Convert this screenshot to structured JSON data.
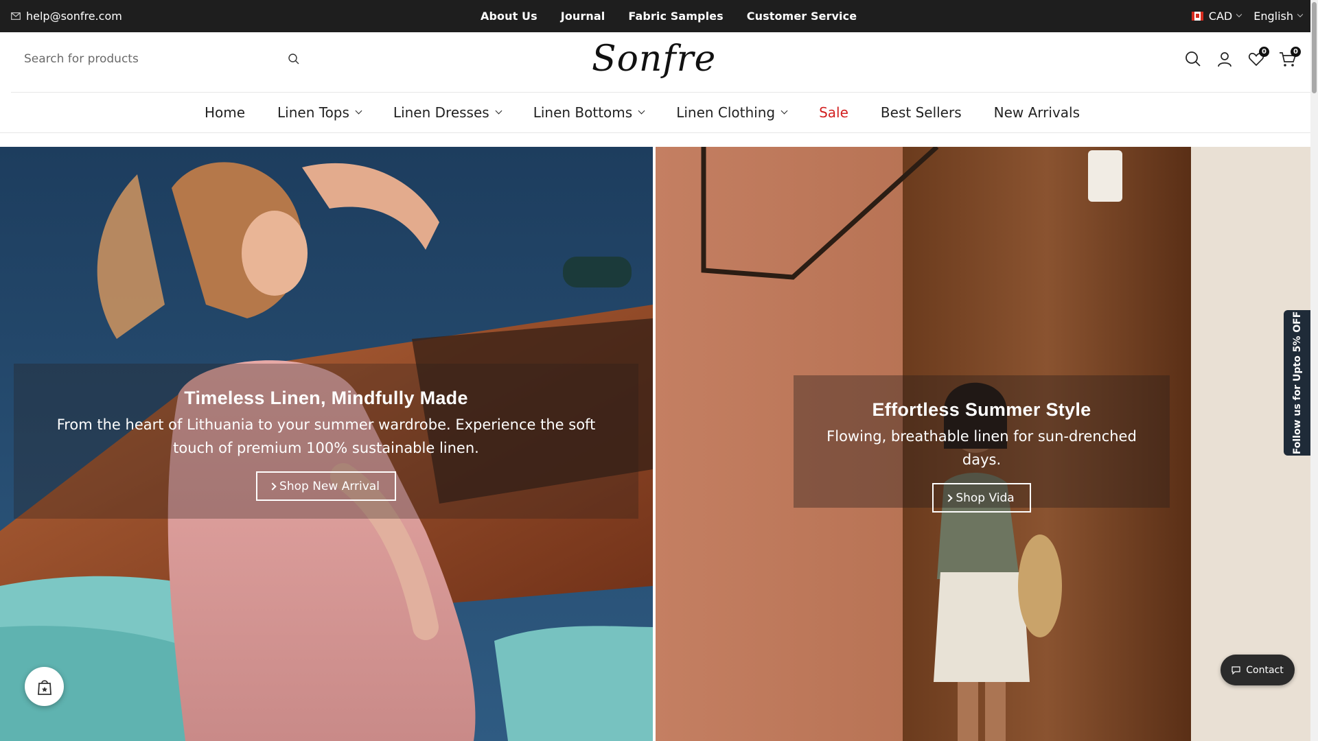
{
  "topbar": {
    "email": "help@sonfre.com",
    "links": [
      "About Us",
      "Journal",
      "Fabric Samples",
      "Customer Service"
    ],
    "currency": "CAD",
    "language": "English"
  },
  "header": {
    "search_placeholder": "Search for products",
    "logo": "Sonfre",
    "wishlist_count": "0",
    "cart_count": "0"
  },
  "nav": {
    "items": [
      {
        "label": "Home"
      },
      {
        "label": "Linen Tops"
      },
      {
        "label": "Linen Dresses"
      },
      {
        "label": "Linen Bottoms"
      },
      {
        "label": "Linen Clothing"
      },
      {
        "label": "Sale"
      },
      {
        "label": "Best Sellers"
      },
      {
        "label": "New Arrivals"
      }
    ]
  },
  "hero": {
    "left": {
      "title": "Timeless Linen, Mindfully Made",
      "text": "From the heart of Lithuania to your summer wardrobe. Experience the soft touch of premium 100% sustainable linen.",
      "button": "Shop New Arrival"
    },
    "right": {
      "title": "Effortless Summer Style",
      "text": "Flowing, breathable linen for sun-drenched days.",
      "button": "Shop Vida"
    }
  },
  "floating": {
    "side_tab": "Follow us for Upto 5% OFF",
    "contact": "Contact"
  },
  "colors": {
    "topbar_bg": "#1e1e1e",
    "sale": "#d21f1f",
    "side_tab_bg": "#1f2b38"
  }
}
